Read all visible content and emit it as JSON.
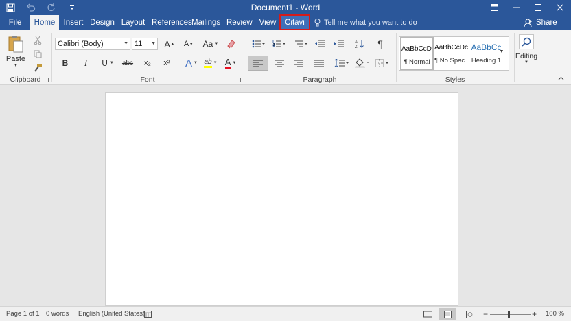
{
  "window": {
    "title": "Document1  -  Word"
  },
  "tabs": {
    "file": "File",
    "home": "Home",
    "insert": "Insert",
    "design": "Design",
    "layout": "Layout",
    "references": "References",
    "mailings": "Mailings",
    "review": "Review",
    "view": "View",
    "citavi": "Citavi"
  },
  "tellme": {
    "placeholder": "Tell me what you want to do"
  },
  "share": {
    "label": "Share"
  },
  "clipboard": {
    "paste": "Paste",
    "group_label": "Clipboard"
  },
  "font": {
    "name": "Calibri (Body)",
    "size": "11",
    "bold": "B",
    "italic": "I",
    "underline": "U",
    "strike": "abc",
    "subscript": "x₂",
    "superscript": "x²",
    "grow": "A",
    "shrink": "A",
    "change_case": "Aa",
    "highlight": "ab",
    "font_color": "A",
    "text_effects": "A",
    "group_label": "Font"
  },
  "paragraph": {
    "group_label": "Paragraph",
    "pilcrow": "¶"
  },
  "styles": {
    "group_label": "Styles",
    "items": [
      {
        "preview": "AaBbCcDc",
        "name": "¶ Normal"
      },
      {
        "preview": "AaBbCcDc",
        "name": "¶ No Spac..."
      },
      {
        "preview": "AaBbCc",
        "name": "Heading 1"
      }
    ]
  },
  "editing": {
    "label": "Editing"
  },
  "statusbar": {
    "page": "Page 1 of 1",
    "words": "0 words",
    "language": "English (United States)",
    "zoom": "100 %"
  },
  "colors": {
    "accent": "#2b579a",
    "highlight_red": "#d41b1b"
  }
}
